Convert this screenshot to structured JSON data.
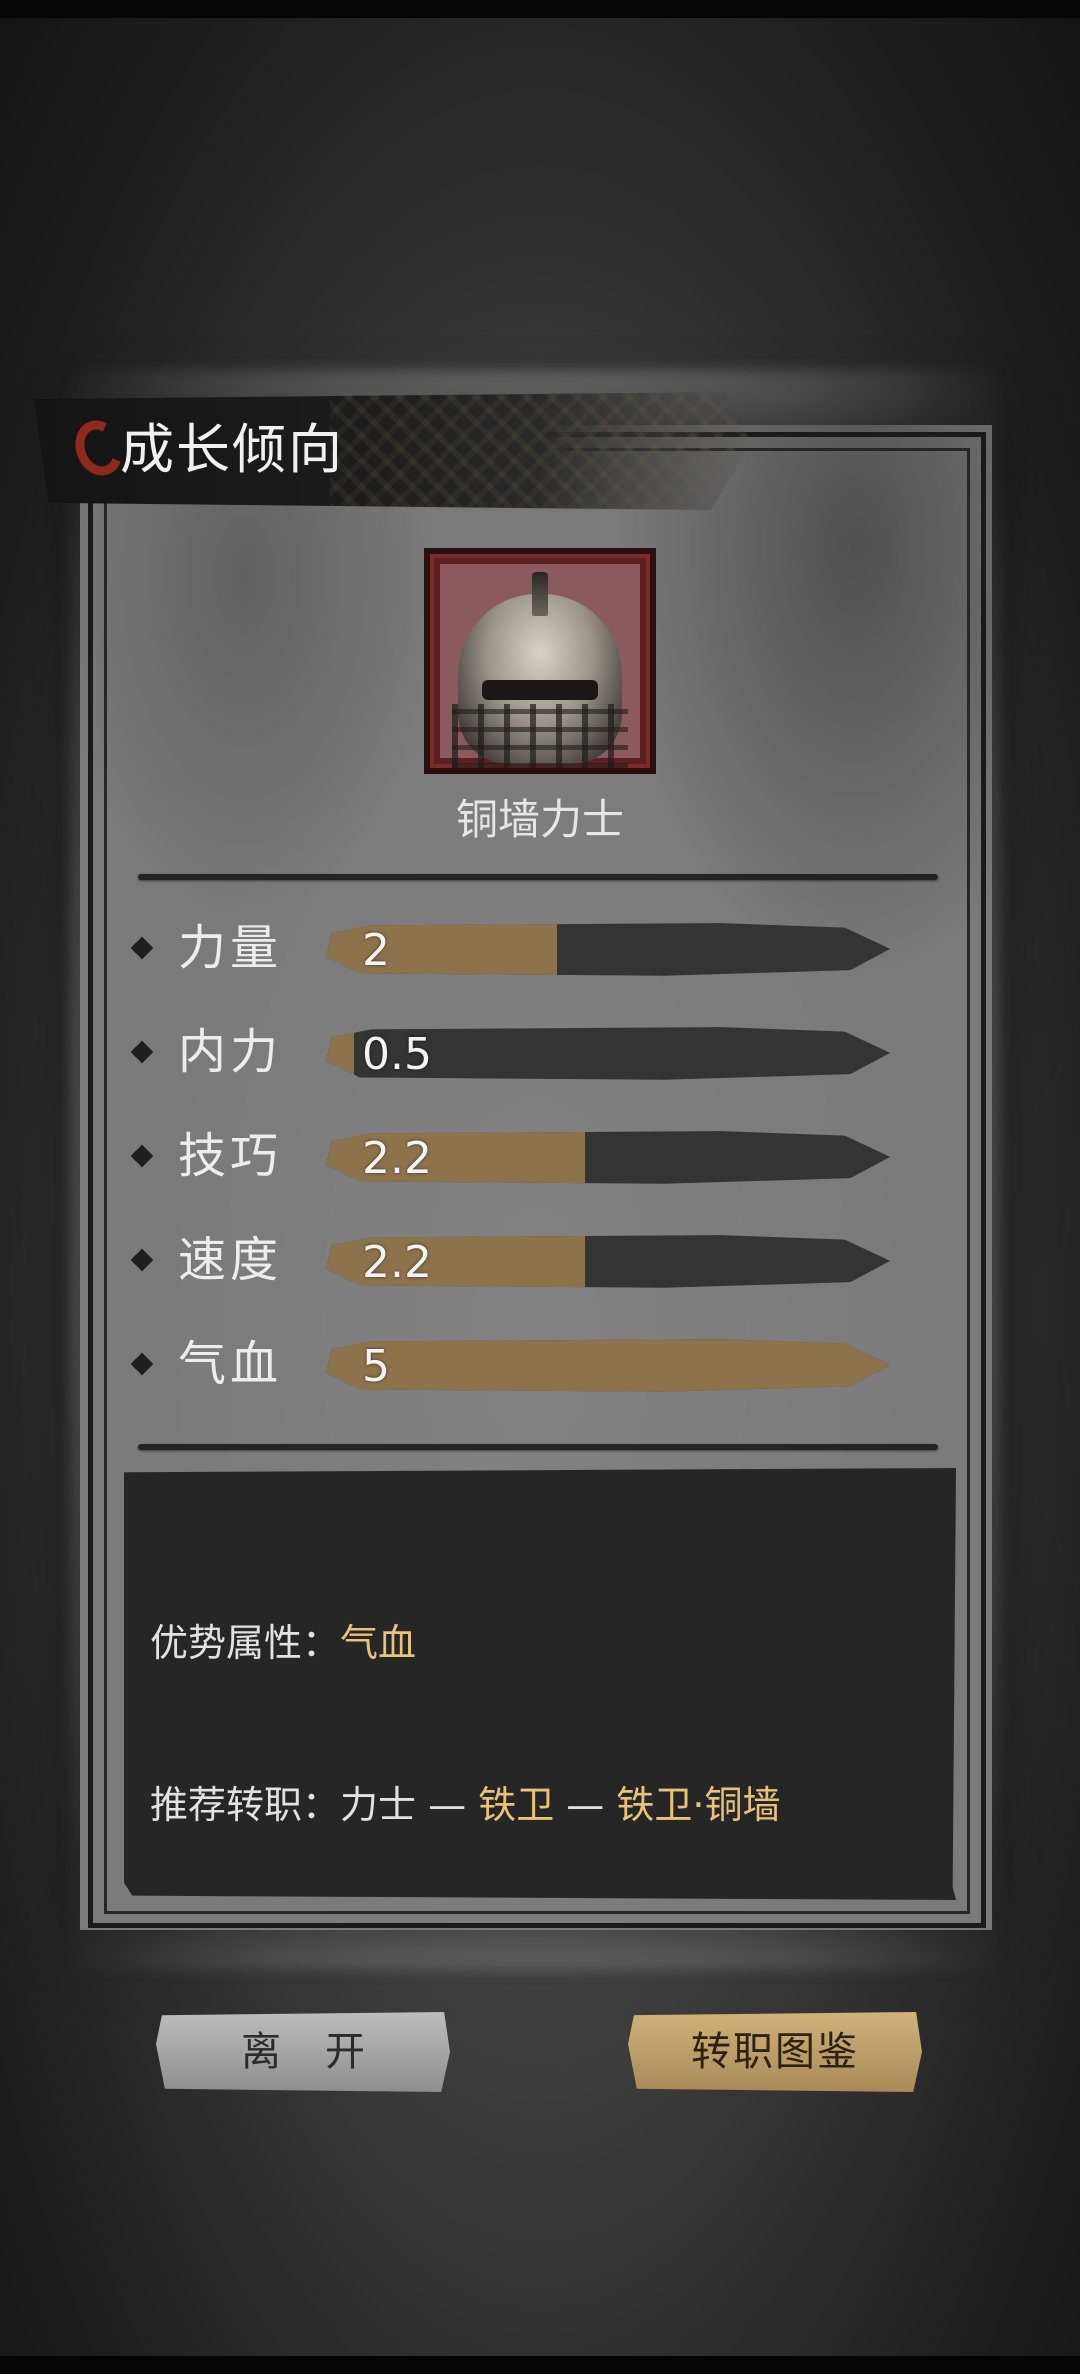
{
  "title": "成长倾向",
  "character": {
    "name": "铜墙力士"
  },
  "stats": [
    {
      "label": "力量",
      "value": "2",
      "fill": 0.41
    },
    {
      "label": "内力",
      "value": "0.5",
      "fill": 0.05
    },
    {
      "label": "技巧",
      "value": "2.2",
      "fill": 0.46
    },
    {
      "label": "速度",
      "value": "2.2",
      "fill": 0.46
    },
    {
      "label": "气血",
      "value": "5",
      "fill": 1.0
    }
  ],
  "info": {
    "advantage_label": "优势属性：",
    "advantage_value": "气血",
    "recommend_label": "推荐转职：",
    "path_start": "力士",
    "separator_1": " — ",
    "path_mid": "铁卫",
    "separator_2": " — ",
    "path_end": "铁卫·铜墙"
  },
  "buttons": {
    "leave": "离开",
    "guide": "转职图鉴"
  },
  "colors": {
    "accent_gold": "#e9c27a",
    "bar_fill": "#8d734c",
    "bar_track": "#343434",
    "title_ring": "#8e2a1c"
  },
  "icons": {
    "portrait": "armored-helmet-portrait",
    "bullet": "diamond-bullet-icon"
  }
}
